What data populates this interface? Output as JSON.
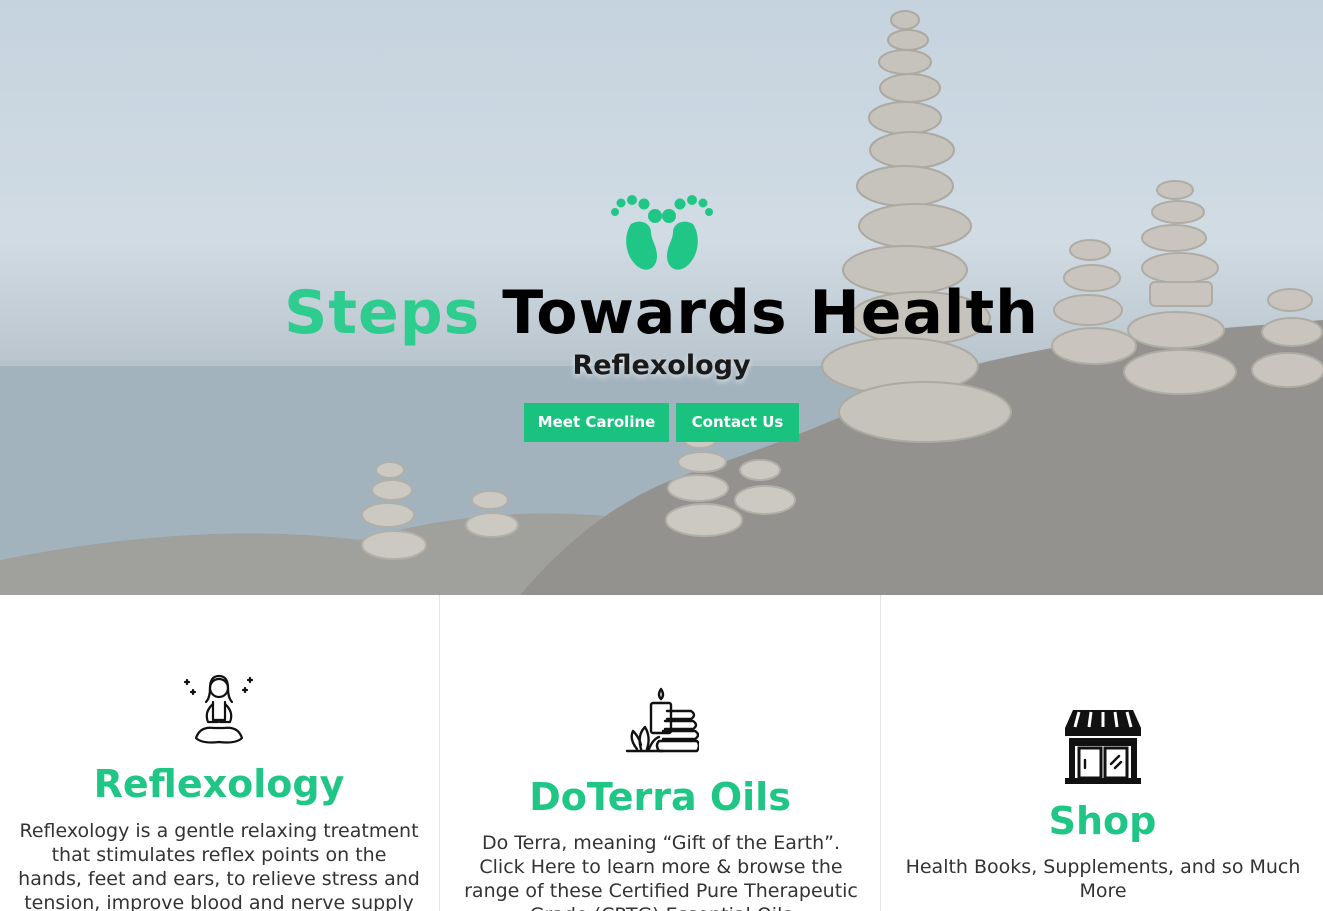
{
  "hero": {
    "title_part1": "Steps",
    "title_part2": "Towards Health",
    "subtitle": "Reflexology",
    "buttons": {
      "meet_label": "Meet Caroline",
      "contact_label": "Contact Us"
    },
    "logo_icon": "footprints-icon",
    "accent_color": "#19c27f"
  },
  "features": [
    {
      "icon": "meditation-woman-icon",
      "title": "Reflexology",
      "text": "Reflexology is a gentle relaxing treatment that stimulates reflex points on the hands, feet and ears, to relieve stress and tension, improve blood and nerve supply"
    },
    {
      "icon": "spa-candle-stones-icon",
      "title": "DoTerra Oils",
      "text": "Do Terra, meaning “Gift of the Earth”. Click Here to learn more & browse the range of these Certified Pure Therapeutic Grade (CPTG) Essential Oils"
    },
    {
      "icon": "storefront-icon",
      "title": "Shop",
      "text": "Health Books, Supplements, and so Much More"
    }
  ]
}
